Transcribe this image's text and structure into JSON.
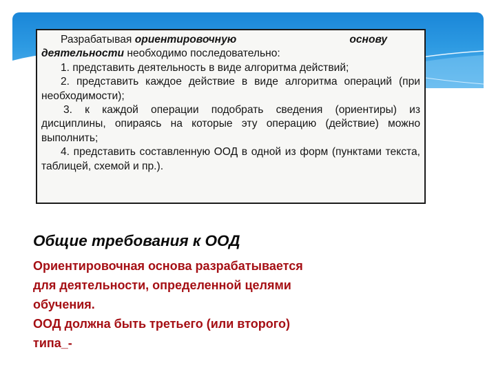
{
  "colors": {
    "banner_top": "#1a86d8",
    "banner_bottom": "#5fb6ee",
    "box_background": "#f7f7f5",
    "box_border": "#1a1a1a",
    "heading_color": "#0a0a0a",
    "body_accent": "#a50f14"
  },
  "box": {
    "intro_lead": "Разрабатывая",
    "intro_bold_1": "ориентировочную",
    "intro_bold_2": "основу",
    "intro_bold_3": "деятельности",
    "intro_tail": "необходимо последовательно:",
    "steps": [
      "1. представить деятельность в виде алгоритма действий;",
      "2. представить каждое действие в виде алгоритма операций (при необходимости);",
      "3. к каждой операции подобрать сведения (ориентиры) из дисциплины, опираясь на которые эту операцию (действие) можно выполнить;",
      "4. представить составленную ООД в одной из форм (пунктами текста, таблицей, схемой и пр.)."
    ]
  },
  "section": {
    "title": "Общие требования к ООД",
    "lines": [
      "Ориентировочная основа разрабатывается",
      "для деятельности, определенной целями",
      "обучения.",
      "ООД должна быть третьего (или второго)",
      "типа_-"
    ]
  }
}
